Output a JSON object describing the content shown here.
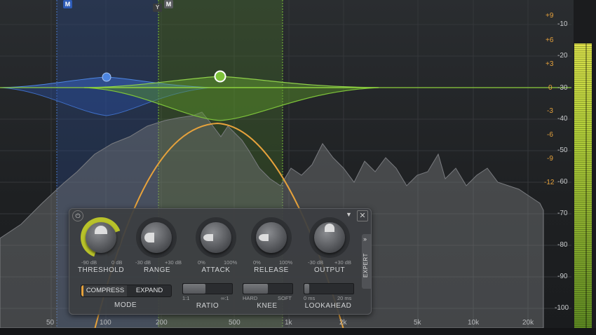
{
  "scale_orange": [
    "+9",
    "+6",
    "+3",
    "0",
    "-3",
    "-6",
    "-9",
    "-12"
  ],
  "scale_gray": [
    "-10",
    "-20",
    "-30",
    "-40",
    "-50",
    "-60",
    "-70",
    "-80",
    "-90",
    "-100"
  ],
  "freq_labels": [
    "50",
    "100",
    "200",
    "500",
    "1k",
    "2k",
    "5k",
    "10k",
    "20k"
  ],
  "band_buttons": {
    "band1": "M",
    "band2": "M",
    "band2_marker": "Y"
  },
  "panel": {
    "knobs": [
      {
        "label": "THRESHOLD",
        "min": "-90 dB",
        "max": "0 dB"
      },
      {
        "label": "RANGE",
        "min": "-30 dB",
        "max": "+30 dB"
      },
      {
        "label": "ATTACK",
        "min": "0%",
        "max": "100%"
      },
      {
        "label": "RELEASE",
        "min": "0%",
        "max": "100%"
      },
      {
        "label": "OUTPUT",
        "min": "-30 dB",
        "max": "+30 dB"
      }
    ],
    "mode": {
      "compress": "COMPRESS",
      "expand": "EXPAND",
      "label": "MODE"
    },
    "ratio": {
      "label": "RATIO",
      "min": "1:1",
      "max": "∞:1"
    },
    "knee": {
      "label": "KNEE",
      "min": "HARD",
      "max": "SOFT"
    },
    "lookahead": {
      "label": "LOOKAHEAD",
      "min": "0 ms",
      "max": "20 ms"
    },
    "expert": "EXPERT"
  },
  "levels": {
    "ratio": 0.45,
    "knee": 0.5,
    "lookahead": 0.1,
    "threshold": 0.7
  },
  "colors": {
    "orange": "#e6a23c",
    "green": "#7dc23a",
    "blue": "#3d74d6",
    "meter": "#a6cc3a"
  }
}
